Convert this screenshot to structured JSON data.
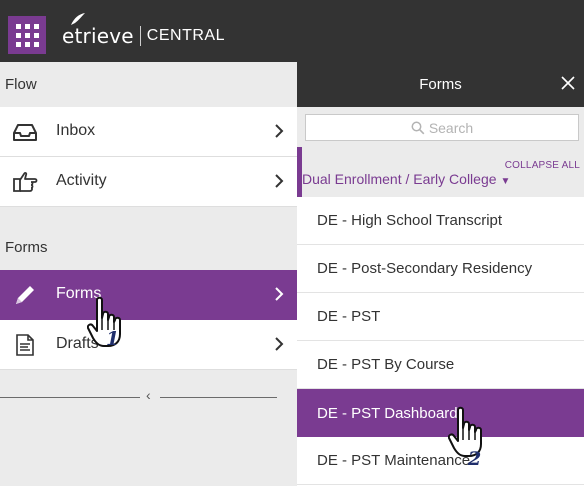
{
  "header": {
    "brand_name": "etrieve",
    "brand_suffix": "CENTRAL"
  },
  "left_panel": {
    "flow_header": "Flow",
    "flow_items": [
      {
        "label": "Inbox",
        "icon": "inbox-tray-icon"
      },
      {
        "label": "Activity",
        "icon": "pointing-hand-icon"
      }
    ],
    "forms_header": "Forms",
    "forms_items": [
      {
        "label": "Forms",
        "icon": "pencil-icon",
        "active": true
      },
      {
        "label": "Drafts",
        "icon": "document-icon"
      }
    ],
    "collapse_glyph": "‹"
  },
  "forms_panel": {
    "title": "Forms",
    "search_placeholder": "Search",
    "collapse_all_label": "COLLAPSE ALL",
    "group_label": "Dual Enrollment / Early College",
    "items": [
      {
        "label": "DE - High School Transcript",
        "active": false
      },
      {
        "label": "DE - Post-Secondary Residency",
        "active": false
      },
      {
        "label": "DE - PST",
        "active": false
      },
      {
        "label": "DE - PST By Course",
        "active": false
      },
      {
        "label": "DE - PST Dashboard",
        "active": true
      },
      {
        "label": "DE - PST Maintenance",
        "active": false
      }
    ]
  },
  "callouts": {
    "step_1": "1",
    "step_2": "2"
  },
  "colors": {
    "accent": "#7a3b91",
    "topbar": "#333333",
    "panel_bg": "#ebebeb",
    "callout_number": "#1f2e6b"
  }
}
